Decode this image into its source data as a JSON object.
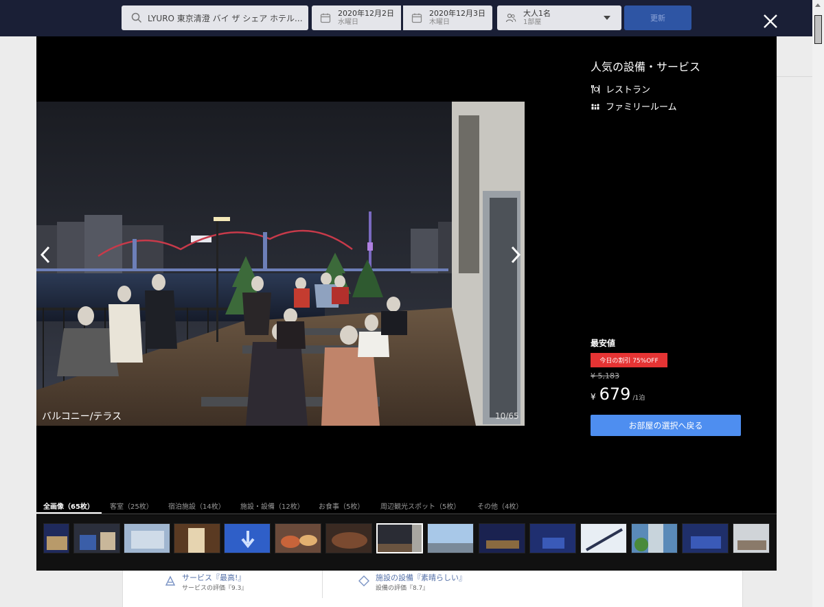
{
  "search": {
    "hotel": "LYURO 東京清澄 バイ ザ シェア ホテル...",
    "checkin": {
      "date": "2020年12月2日",
      "weekday": "水曜日"
    },
    "checkout": {
      "date": "2020年12月3日",
      "weekday": "木曜日"
    },
    "guests": {
      "adults": "大人1名",
      "rooms": "1部屋"
    },
    "update_label": "更新"
  },
  "modal": {
    "photo": {
      "caption": "バルコニー/テラス",
      "counter": "10/65"
    },
    "side": {
      "title": "人気の設備・サービス",
      "amenities": [
        {
          "label": "レストラン",
          "icon": "restaurant-icon"
        },
        {
          "label": "ファミリールーム",
          "icon": "family-icon"
        }
      ],
      "lowest_label": "最安値",
      "discount_badge": "今日の割引 75%OFF",
      "old_price": "¥ 5,183",
      "currency": "¥",
      "price": "679",
      "price_unit": "/1泊",
      "back_button": "お部屋の選択へ戻る"
    },
    "tabs": [
      {
        "label": "全画像（65枚）",
        "active": true
      },
      {
        "label": "客室（25枚）"
      },
      {
        "label": "宿泊施設（14枚）"
      },
      {
        "label": "施設・設備（12枚）"
      },
      {
        "label": "お食事（5枚）"
      },
      {
        "label": "周辺観光スポット（5枚）"
      },
      {
        "label": "その他（4枚）"
      }
    ]
  },
  "background": {
    "service": {
      "title": "サービス『最高!』",
      "sub": "サービスの評価『9.3』"
    },
    "facility": {
      "title": "施設の設備『素晴らしい』",
      "sub": "設備の評価『8.7』"
    }
  },
  "colors": {
    "topbar": "#1a1f36",
    "update_button": "#2e55a4",
    "back_button": "#4e8ef0",
    "discount": "#e53434"
  }
}
